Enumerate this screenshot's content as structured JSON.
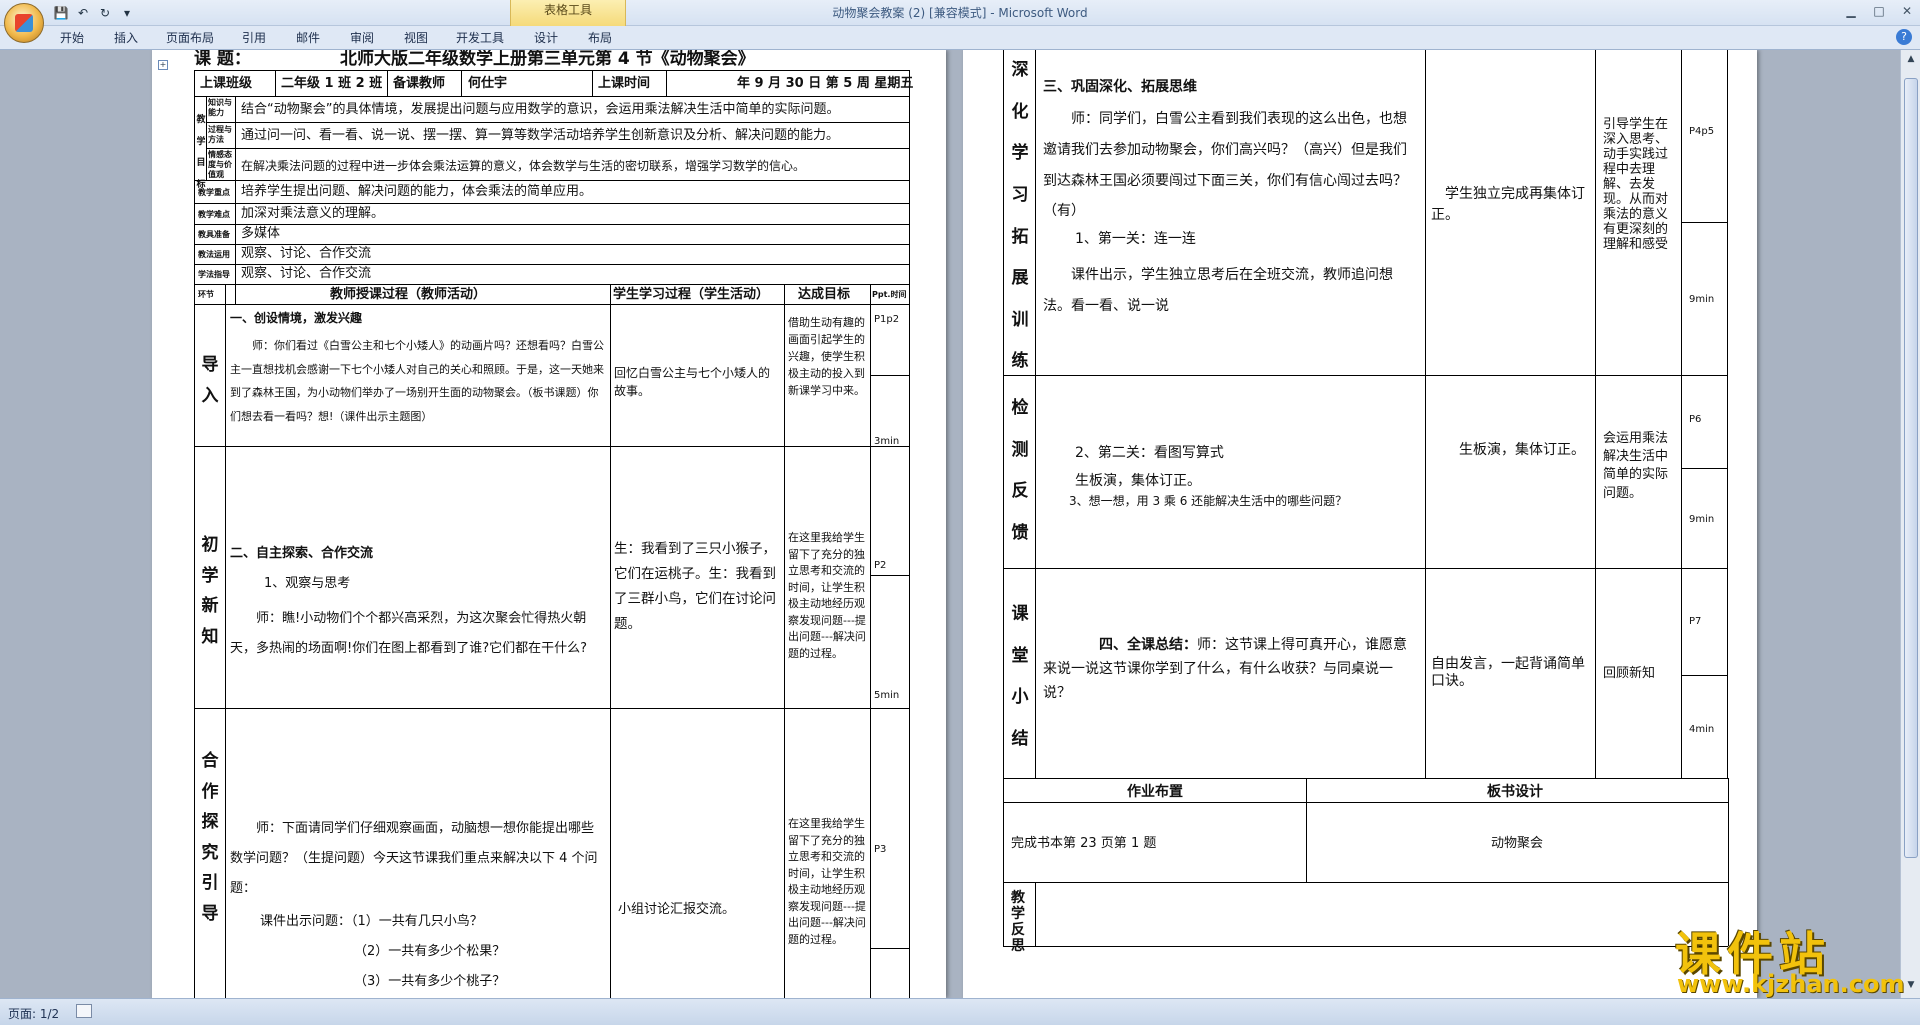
{
  "window": {
    "title": "动物聚会教案 (2) [兼容模式] - Microsoft Word",
    "context_group": "表格工具"
  },
  "qat": {
    "save": "💾",
    "undo": "↶",
    "redo": "↻",
    "more": "▾"
  },
  "ribbon": {
    "tabs": [
      "开始",
      "插入",
      "页面布局",
      "引用",
      "邮件",
      "审阅",
      "视图",
      "开发工具",
      "设计",
      "布局"
    ],
    "help": "?"
  },
  "page1": {
    "heading_label": "课 题：",
    "heading": "北师大版二年级数学上册第三单元第 4 节《动物聚会》",
    "info": {
      "class_label": "上课班级",
      "class_value": "二年级 1 班 2 班",
      "teacher_label": "备课教师",
      "teacher_value": "何仕宇",
      "time_label": "上课时间",
      "time_value": "年 9 月 30 日 第 5 周 星期五"
    },
    "goals_label": "教学目标",
    "goal_sub": [
      "知识与能力",
      "过程与方法",
      "情感态度与价值观"
    ],
    "goals": [
      "结合“动物聚会”的具体情境，发展提出问题与应用数学的意识，会运用乘法解决生活中简单的实际问题。",
      "通过问一问、看一看、说一说、摆一摆、算一算等数学活动培养学生创新意识及分析、解决问题的能力。",
      "在解决乘法问题的过程中进一步体会乘法运算的意义，体会数学与生活的密切联系，增强学习数学的信心。"
    ],
    "rows": [
      {
        "label": "教学重点",
        "value": "培养学生提出问题、解决问题的能力，体会乘法的简单应用。"
      },
      {
        "label": "教学难点",
        "value": "加深对乘法意义的理解。"
      },
      {
        "label": "教具准备",
        "value": "多媒体"
      },
      {
        "label": "教法运用",
        "value": "观察、讨论、合作交流"
      },
      {
        "label": "学法指导",
        "value": "观察、讨论、合作交流"
      }
    ],
    "col_headers": {
      "stage": "环节",
      "teacher": "教师授课过程（教师活动）",
      "student": "学生学习过程（学生活动）",
      "goal": "达成目标",
      "time": "Ppt.时间"
    },
    "sections": [
      {
        "stage": [
          "导",
          "入"
        ],
        "title": "一、创设情境，激发兴趣",
        "paras": [
          "师：你们看过《白雪公主和七个小矮人》的动画片吗？还想看吗？白雪公主一直想找机会感谢一下七个小矮人对自己的关心和照顾。于是，这一天她来到了森林王国，为小动物们举办了一场别开生面的动物聚会。（板书课题）你们想去看一看吗？想!（课件出示主题图）"
        ],
        "student": "回忆白雪公主与七个小矮人的故事。",
        "goal": "借助生动有趣的画面引起学生的兴趣，使学生积极主动的投入到新课学习中来。",
        "ppt": "P1p2",
        "time": "3min"
      },
      {
        "stage": [
          "初",
          "学",
          "新",
          "知"
        ],
        "title": "二、自主探索、合作交流",
        "paras": [
          "1、观察与思考",
          "师：瞧!小动物们个个都兴高采烈，为这次聚会忙得热火朝天，多热闹的场面啊!你们在图上都看到了谁?它们都在干什么?"
        ],
        "student": "生：我看到了三只小猴子，它们在运桃子。生：我看到了三群小鸟，它们在讨论问题。",
        "goal": "在这里我给学生留下了充分的独立思考和交流的时间，让学生积极主动地经历观察发现问题---提出问题---解决问题的过程。",
        "ppt": "P2",
        "time": "5min"
      },
      {
        "stage": [
          "合",
          "作",
          "探",
          "究",
          "引",
          "导"
        ],
        "title": "",
        "paras": [
          "师：下面请同学们仔细观察画面，动脑想一想你能提出哪些数学问题？（生提问题）今天这节课我们重点来解决以下 4 个问题：",
          "课件出示问题：（1）一共有几只小鸟？",
          "（2）一共有多少个松果？",
          "（3）一共有多少个桃子？"
        ],
        "student": "小组讨论汇报交流。",
        "goal": "在这里我给学生留下了充分的独立思考和交流的时间，让学生积极主动地经历观察发现问题---提出问题---解决问题的过程。",
        "ppt": "P3",
        "time": ""
      }
    ]
  },
  "page2": {
    "sections": [
      {
        "stage": [
          "深",
          "化",
          "学",
          "习",
          "拓",
          "展",
          "训",
          "练"
        ],
        "title": "三、巩固深化、拓展思维",
        "paras": [
          "师：同学们，白雪公主看到我们表现的这么出色，也想邀请我们去参加动物聚会，你们高兴吗？（高兴）但是我们到达森林王国必须要闯过下面三关，你们有信心闯过去吗？（有）",
          "1、第一关：连一连",
          "课件出示，学生独立思考后在全班交流，教师追问想法。看一看、说一说"
        ],
        "student": "学生独立完成再集体订正。",
        "goal": "引导学生在深入思考、动手实践过程中去理解、去发现。从而对乘法的意义有更深刻的理解和感受",
        "ppt": "P4p5",
        "time": "9min"
      },
      {
        "stage": [
          "检",
          "测",
          "反",
          "馈"
        ],
        "title": "",
        "paras": [
          "2、第二关：看图写算式",
          "生板演，集体订正。",
          "3、想一想，用 3 乘 6 还能解决生活中的哪些问题？"
        ],
        "student": "生板演，集体订正。",
        "goal": "会运用乘法解决生活中简单的实际问题。",
        "ppt": "P6",
        "time": "9min"
      },
      {
        "stage": [
          "课",
          "堂",
          "小",
          "结"
        ],
        "title": "四、全课总结：",
        "paras": [
          "师：这节课上得可真开心，谁愿意来说一说这节课你学到了什么，有什么收获？与同桌说一说？"
        ],
        "student": "自由发言，一起背诵简单口诀。",
        "goal": "回顾新知",
        "ppt": "P7",
        "time": "4min"
      }
    ],
    "homework_label": "作业布置",
    "homework": "完成书本第 23 页第 1 题",
    "board_label": "板书设计",
    "board": "动物聚会",
    "reflection_label": "教学反思"
  },
  "status": {
    "page": "页面: 1/2"
  },
  "watermark": {
    "title": "课件站",
    "url": "www.kjzhan.com"
  }
}
